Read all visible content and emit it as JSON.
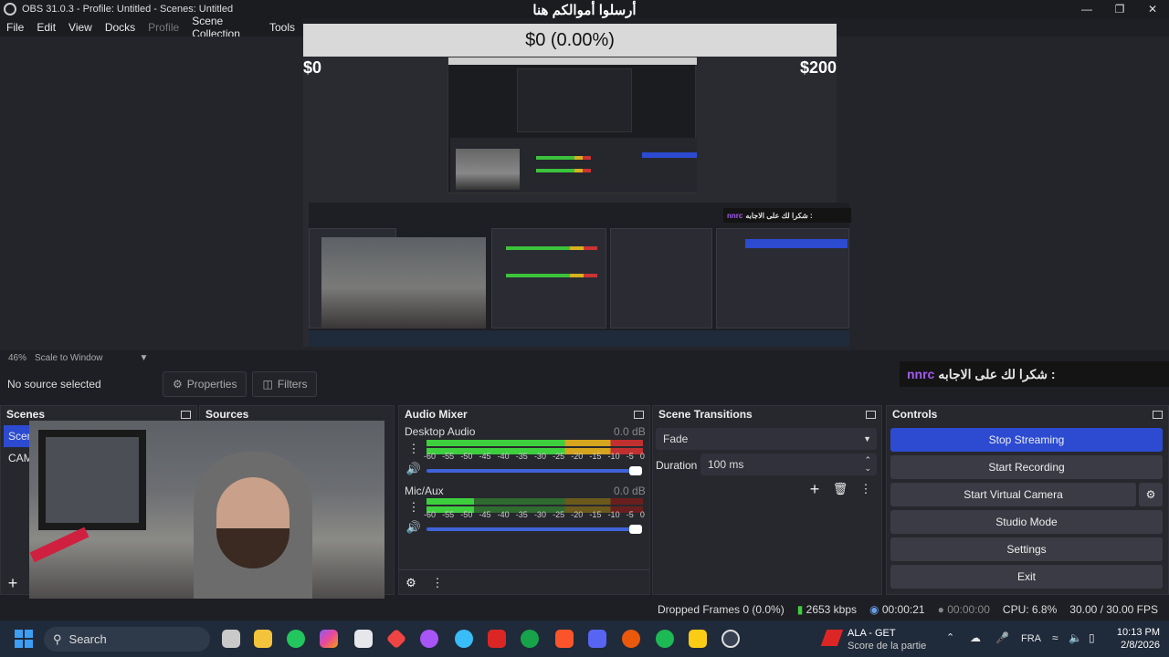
{
  "window": {
    "title": "OBS 31.0.3 - Profile: Untitled - Scenes: Untitled"
  },
  "menu": [
    "File",
    "Edit",
    "View",
    "Docks",
    "Profile",
    "Scene Collection",
    "Tools"
  ],
  "preview": {
    "overlay_title": "أرسلوا أموالكم هنا",
    "donation": {
      "text": "$0 (0.00%)",
      "min": "$0",
      "max": "$200"
    }
  },
  "zoom": {
    "level": "46%",
    "mode": "Scale to Window"
  },
  "source_toolbar": {
    "no_source": "No source selected",
    "properties": "Properties",
    "filters": "Filters"
  },
  "chat_overlay": {
    "user": "nnrc",
    "message": "شكرا لك على الاجابه :"
  },
  "scenes": {
    "title": "Scenes",
    "items": [
      "Scene",
      "CAM"
    ]
  },
  "sources": {
    "title": "Sources"
  },
  "audio_mixer": {
    "title": "Audio Mixer",
    "channels": [
      {
        "name": "Desktop Audio",
        "db": "0.0 dB"
      },
      {
        "name": "Mic/Aux",
        "db": "0.0 dB"
      }
    ],
    "ticks": [
      "-60",
      "-55",
      "-50",
      "-45",
      "-40",
      "-35",
      "-30",
      "-25",
      "-20",
      "-15",
      "-10",
      "-5",
      "0"
    ]
  },
  "transitions": {
    "title": "Scene Transitions",
    "type": "Fade",
    "duration_label": "Duration",
    "duration": "100 ms"
  },
  "controls": {
    "title": "Controls",
    "stop_streaming": "Stop Streaming",
    "start_recording": "Start Recording",
    "start_virtual_camera": "Start Virtual Camera",
    "studio_mode": "Studio Mode",
    "settings": "Settings",
    "exit": "Exit"
  },
  "status": {
    "dropped": "Dropped Frames 0 (0.0%)",
    "bitrate": "2653 kbps",
    "stream_time": "00:00:21",
    "rec_time": "00:00:00",
    "cpu": "CPU: 6.8%",
    "fps": "30.00 / 30.00 FPS"
  },
  "taskbar": {
    "search": "Search",
    "notification_title": "ALA - GET",
    "notification_sub": "Score de la partie",
    "lang": "FRA",
    "time": "10:13 PM",
    "date": "2/8/2026"
  },
  "colors": {
    "accent": "#2c4bd1",
    "bg": "#1e1f24",
    "dock": "#27282e",
    "chat_user": "#a45cf0"
  }
}
